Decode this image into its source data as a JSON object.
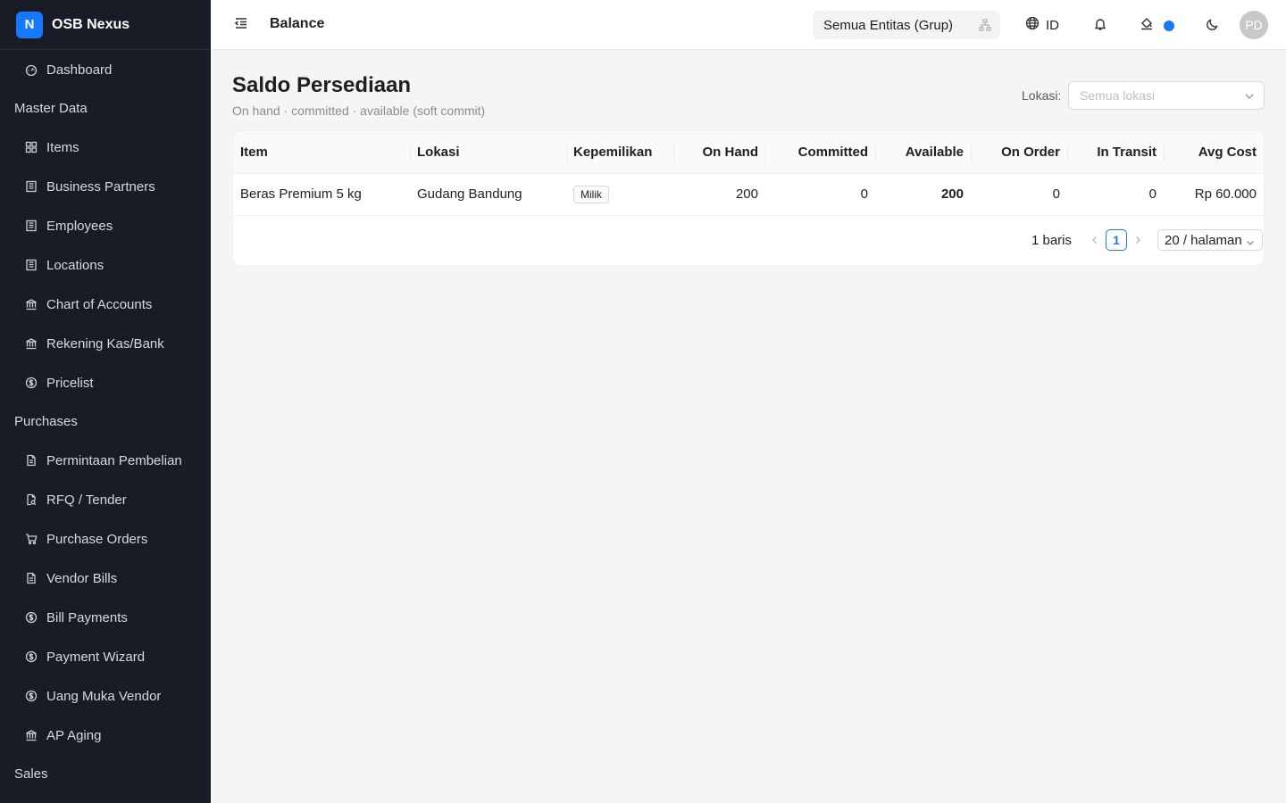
{
  "app": {
    "logo_letter": "N",
    "name": "OSB Nexus",
    "accent_color": "#1677ff",
    "sidebar_bg": "#171c26"
  },
  "sidebar": {
    "items": [
      {
        "type": "item",
        "label": "Dashboard",
        "icon": "dashboard-icon"
      },
      {
        "type": "group",
        "label": "Master Data"
      },
      {
        "type": "item",
        "label": "Items",
        "icon": "grid-icon"
      },
      {
        "type": "item",
        "label": "Business Partners",
        "icon": "building-icon"
      },
      {
        "type": "item",
        "label": "Employees",
        "icon": "building-icon"
      },
      {
        "type": "item",
        "label": "Locations",
        "icon": "building-icon"
      },
      {
        "type": "item",
        "label": "Chart of Accounts",
        "icon": "bank-icon"
      },
      {
        "type": "item",
        "label": "Rekening Kas/Bank",
        "icon": "bank-icon"
      },
      {
        "type": "item",
        "label": "Pricelist",
        "icon": "dollar-circle-icon"
      },
      {
        "type": "group",
        "label": "Purchases"
      },
      {
        "type": "item",
        "label": "Permintaan Pembelian",
        "icon": "file-icon"
      },
      {
        "type": "item",
        "label": "RFQ / Tender",
        "icon": "file-search-icon"
      },
      {
        "type": "item",
        "label": "Purchase Orders",
        "icon": "cart-icon"
      },
      {
        "type": "item",
        "label": "Vendor Bills",
        "icon": "file-icon"
      },
      {
        "type": "item",
        "label": "Bill Payments",
        "icon": "dollar-circle-icon"
      },
      {
        "type": "item",
        "label": "Payment Wizard",
        "icon": "dollar-circle-icon"
      },
      {
        "type": "item",
        "label": "Uang Muka Vendor",
        "icon": "dollar-circle-icon"
      },
      {
        "type": "item",
        "label": "AP Aging",
        "icon": "bank-icon"
      },
      {
        "type": "group",
        "label": "Sales"
      }
    ]
  },
  "header": {
    "title": "Balance",
    "entity_select": "Semua Entitas (Grup)",
    "language": "ID",
    "avatar_initials": "PD"
  },
  "page": {
    "title": "Saldo Persediaan",
    "subtitle": "On hand · committed · available (soft commit)",
    "location_label": "Lokasi:",
    "location_placeholder": "Semua lokasi"
  },
  "table": {
    "columns": [
      "Item",
      "Lokasi",
      "Kepemilikan",
      "On Hand",
      "Committed",
      "Available",
      "On Order",
      "In Transit",
      "Avg Cost"
    ],
    "rows": [
      {
        "item": "Beras Premium 5 kg",
        "lokasi": "Gudang Bandung",
        "kepemilikan": "Milik",
        "on_hand": "200",
        "committed": "0",
        "available": "200",
        "on_order": "0",
        "in_transit": "0",
        "avg_cost": "Rp 60.000"
      }
    ]
  },
  "pagination": {
    "total": "1 baris",
    "current_page": "1",
    "page_size": "20 / halaman"
  }
}
